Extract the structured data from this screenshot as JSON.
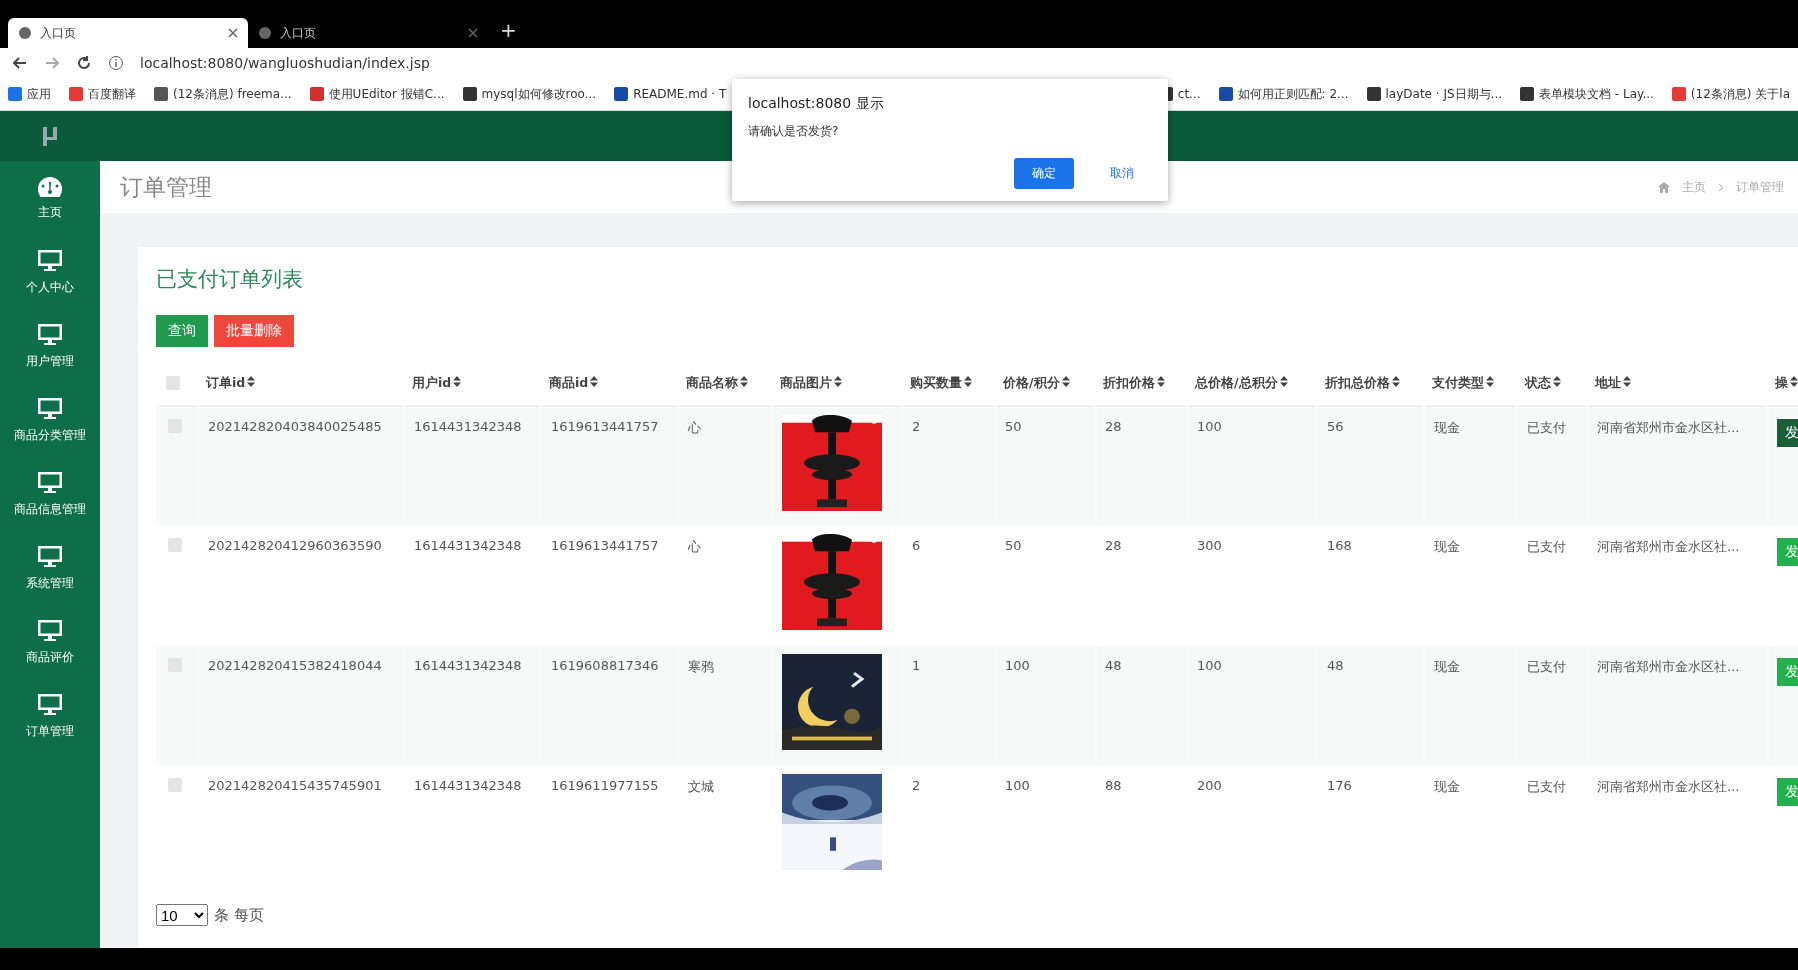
{
  "browser": {
    "tabs": [
      {
        "title": "入口页",
        "selected": true
      },
      {
        "title": "入口页",
        "selected": false
      }
    ],
    "new_tab": "+",
    "url": "localhost:8080/wangluoshudian/index.jsp",
    "bookmarks_left": [
      "应用",
      "百度翻译",
      "(12条消息) freema...",
      "使用UEditor 报错C...",
      "mysql如何修改roo...",
      "README.md · T"
    ],
    "bookmarks_right": [
      "ct...",
      "如何用正则匹配: 2...",
      "layDate · JS日期与...",
      "表单模块文档 - Lay...",
      "(12条消息) 关于la"
    ]
  },
  "sidebar": {
    "items": [
      {
        "label": "主页",
        "selected": false
      },
      {
        "label": "个人中心",
        "selected": false
      },
      {
        "label": "用户管理",
        "selected": false
      },
      {
        "label": "商品分类管理",
        "selected": false
      },
      {
        "label": "商品信息管理",
        "selected": false
      },
      {
        "label": "系统管理",
        "selected": false
      },
      {
        "label": "商品评价",
        "selected": false
      },
      {
        "label": "订单管理",
        "selected": false
      }
    ]
  },
  "page": {
    "title": "订单管理",
    "breadcrumb": [
      "主页",
      "订单管理"
    ]
  },
  "card": {
    "title": "已支付订单列表",
    "buttons": [
      {
        "label": "查询",
        "kind": "primary"
      },
      {
        "label": "批量删除",
        "kind": "danger"
      }
    ]
  },
  "table": {
    "select_all_checked": false,
    "columns": [
      "订单id",
      "用户id",
      "商品id",
      "商品名称",
      "商品图片",
      "购买数量",
      "价格/积分",
      "折扣价格",
      "总价格/总积分",
      "折扣总价格",
      "支付类型",
      "状态",
      "地址",
      "操"
    ],
    "rows": [
      {
        "checked": false,
        "cells": [
          "202142820403840025485",
          "1614431342348",
          "1619613441757",
          "心"
        ],
        "rest": [
          "2",
          "50",
          "28",
          "100",
          "56",
          "现金",
          "已支付",
          "河南省郑州市金水区社..."
        ],
        "action": "发",
        "hovered": true
      },
      {
        "checked": false,
        "cells": [
          "202142820412960363590",
          "1614431342348",
          "1619613441757",
          "心"
        ],
        "rest": [
          "6",
          "50",
          "28",
          "300",
          "168",
          "现金",
          "已支付",
          "河南省郑州市金水区社..."
        ],
        "action": "发",
        "hovered": false
      },
      {
        "checked": false,
        "cells": [
          "202142820415382418044",
          "1614431342348",
          "1619608817346",
          "寒鸦"
        ],
        "rest": [
          "1",
          "100",
          "48",
          "100",
          "48",
          "现金",
          "已支付",
          "河南省郑州市金水区社..."
        ],
        "action": "发",
        "hovered": false
      },
      {
        "checked": false,
        "cells": [
          "202142820415435745901",
          "1614431342348",
          "1619611977155",
          "文城"
        ],
        "rest": [
          "2",
          "100",
          "88",
          "200",
          "176",
          "现金",
          "已支付",
          "河南省郑州市金水区社..."
        ],
        "action": "发",
        "hovered": false
      }
    ]
  },
  "pager": {
    "page_size": "10",
    "label": "条 每页"
  },
  "dialog": {
    "title": "localhost:8080 显示",
    "message": "请确认是否发货?",
    "buttons": [
      {
        "label": "确定",
        "kind": "primary"
      },
      {
        "label": "取消",
        "kind": "plain"
      }
    ]
  }
}
